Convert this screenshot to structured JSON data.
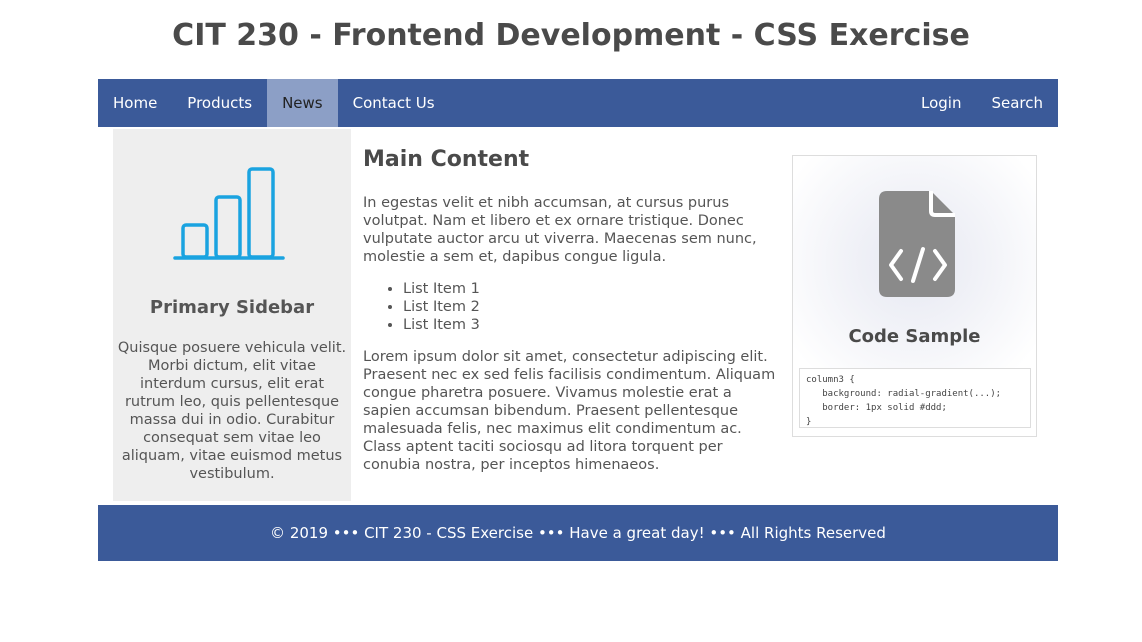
{
  "header": {
    "title": "CIT 230 - Frontend Development - CSS Exercise"
  },
  "nav": {
    "left": [
      {
        "label": "Home",
        "active": false
      },
      {
        "label": "Products",
        "active": false
      },
      {
        "label": "News",
        "active": true
      },
      {
        "label": "Contact Us",
        "active": false
      }
    ],
    "right": [
      {
        "label": "Login"
      },
      {
        "label": "Search"
      }
    ]
  },
  "sidebar": {
    "icon": "bar-chart-icon",
    "title": "Primary Sidebar",
    "text": "Quisque posuere vehicula velit. Morbi dictum, elit vitae interdum cursus, elit erat rutrum leo, quis pellentesque massa dui in odio. Curabitur consequat sem vitae leo aliquam, vitae euismod metus vestibulum."
  },
  "main": {
    "heading": "Main Content",
    "paragraph1": "In egestas velit et nibh accumsan, at cursus purus volutpat. Nam et libero et ex ornare tristique. Donec vulputate auctor arcu ut viverra. Maecenas sem nunc, molestie a sem et, dapibus congue ligula.",
    "list": [
      "List Item 1",
      "List Item 2",
      "List Item 3"
    ],
    "paragraph2": "Lorem ipsum dolor sit amet, consectetur adipiscing elit. Praesent nec ex sed felis facilisis condimentum. Aliquam congue pharetra posuere. Vivamus molestie erat a sapien accumsan bibendum. Praesent pellentesque malesuada felis, nec maximus elit condimentum ac. Class aptent taciti sociosqu ad litora torquent per conubia nostra, per inceptos himenaeos."
  },
  "code_sample": {
    "icon": "code-file-icon",
    "title": "Code Sample",
    "code": "column3 {\n   background: radial-gradient(...);\n   border: 1px solid #ddd;\n}"
  },
  "footer": {
    "text": "© 2019 ••• CIT 230 - CSS Exercise ••• Have a great day! ••• All Rights Reserved"
  },
  "colors": {
    "nav_bg": "#3b5a99",
    "nav_active_bg": "#8c9fc6",
    "sidebar_bg": "#eeeeee",
    "chart_icon": "#1aa3e0",
    "code_icon": "#8a8a8a"
  }
}
